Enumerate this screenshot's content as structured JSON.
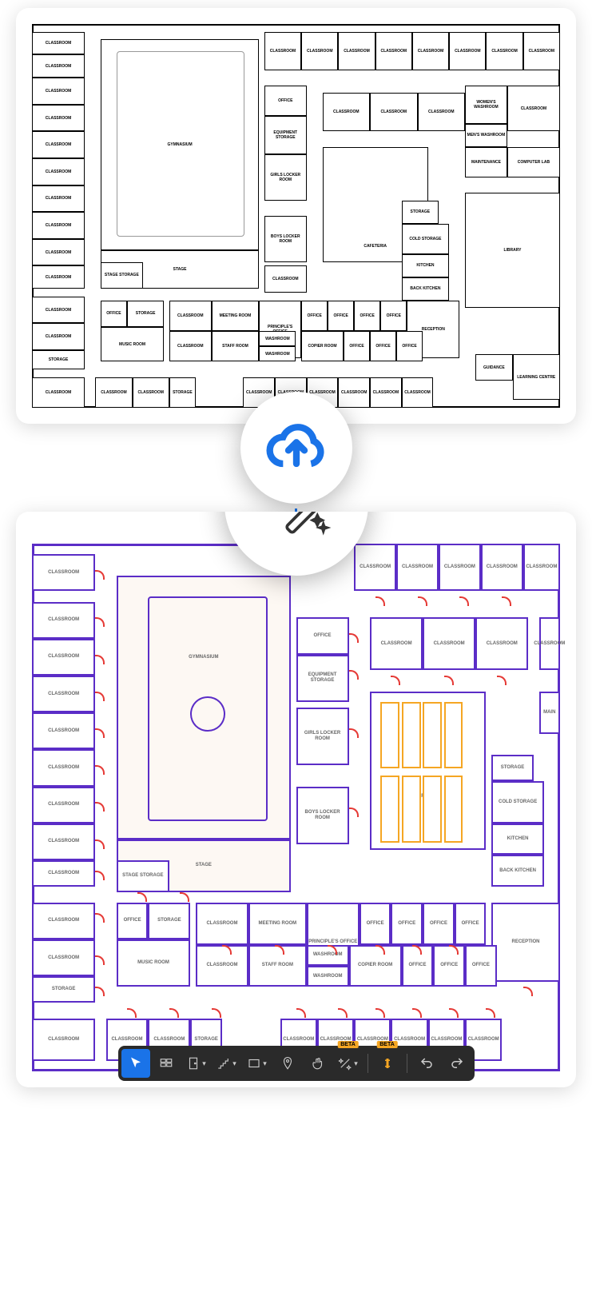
{
  "rooms_top": {
    "gymnasium": "GYMNASIUM",
    "stage": "STAGE",
    "stage_storage": "STAGE STORAGE",
    "office": "OFFICE",
    "equipment_storage": "EQUIPMENT STORAGE",
    "girls_locker": "GIRLS LOCKER ROOM",
    "boys_locker": "BOYS LOCKER ROOM",
    "cafeteria": "CAFETERIA",
    "cold_storage": "COLD STORAGE",
    "kitchen": "KITCHEN",
    "back_kitchen": "BACK KITCHEN",
    "library": "LIBRARY",
    "computer_lab": "COMPUTER LAB",
    "maintenance": "MAINTENANCE",
    "womens_washroom": "WOMEN'S WASHROOM",
    "mens_washroom": "MEN'S WASHROOM",
    "reception": "RECEPTION",
    "principals_office": "PRINCIPLE'S OFFICE",
    "meeting_room": "MEETING ROOM",
    "staff_room": "STAFF ROOM",
    "music_room": "MUSIC ROOM",
    "washroom": "WASHROOM",
    "copier_room": "COPIER ROOM",
    "guidance": "GUIDANCE",
    "learning_centre": "LEARNING CENTRE",
    "storage": "STORAGE",
    "classroom": "CLASSROOM"
  },
  "rooms_bottom": {
    "gymnasium": "GYMNASIUM",
    "stage": "STAGE",
    "stage_storage": "STAGE STORAGE",
    "office": "OFFICE",
    "equipment_storage": "EQUIPMENT STORAGE",
    "girls_locker": "GIRLS LOCKER ROOM",
    "boys_locker": "BOYS LOCKER ROOM",
    "cafeteria": "CAFETERIA",
    "cold_storage": "COLD STORAGE",
    "kitchen": "KITCHEN",
    "back_kitchen": "BACK KITCHEN",
    "maintenance": "MAIN",
    "reception": "RECEPTION",
    "principals_office": "PRINCIPLE'S OFFICE",
    "meeting_room": "MEETING ROOM",
    "staff_room": "STAFF ROOM",
    "music_room": "MUSIC ROOM",
    "washroom": "WASHROOM",
    "copier_room": "COPIER ROOM",
    "storage": "STORAGE",
    "classroom": "CLASSROOM"
  },
  "toolbar": {
    "beta": "BETA"
  },
  "colors": {
    "purple": "#5b2dc7",
    "red_door": "#e53935",
    "orange": "#f5a623",
    "blue": "#1a73e8",
    "teal": "#26c6da"
  }
}
